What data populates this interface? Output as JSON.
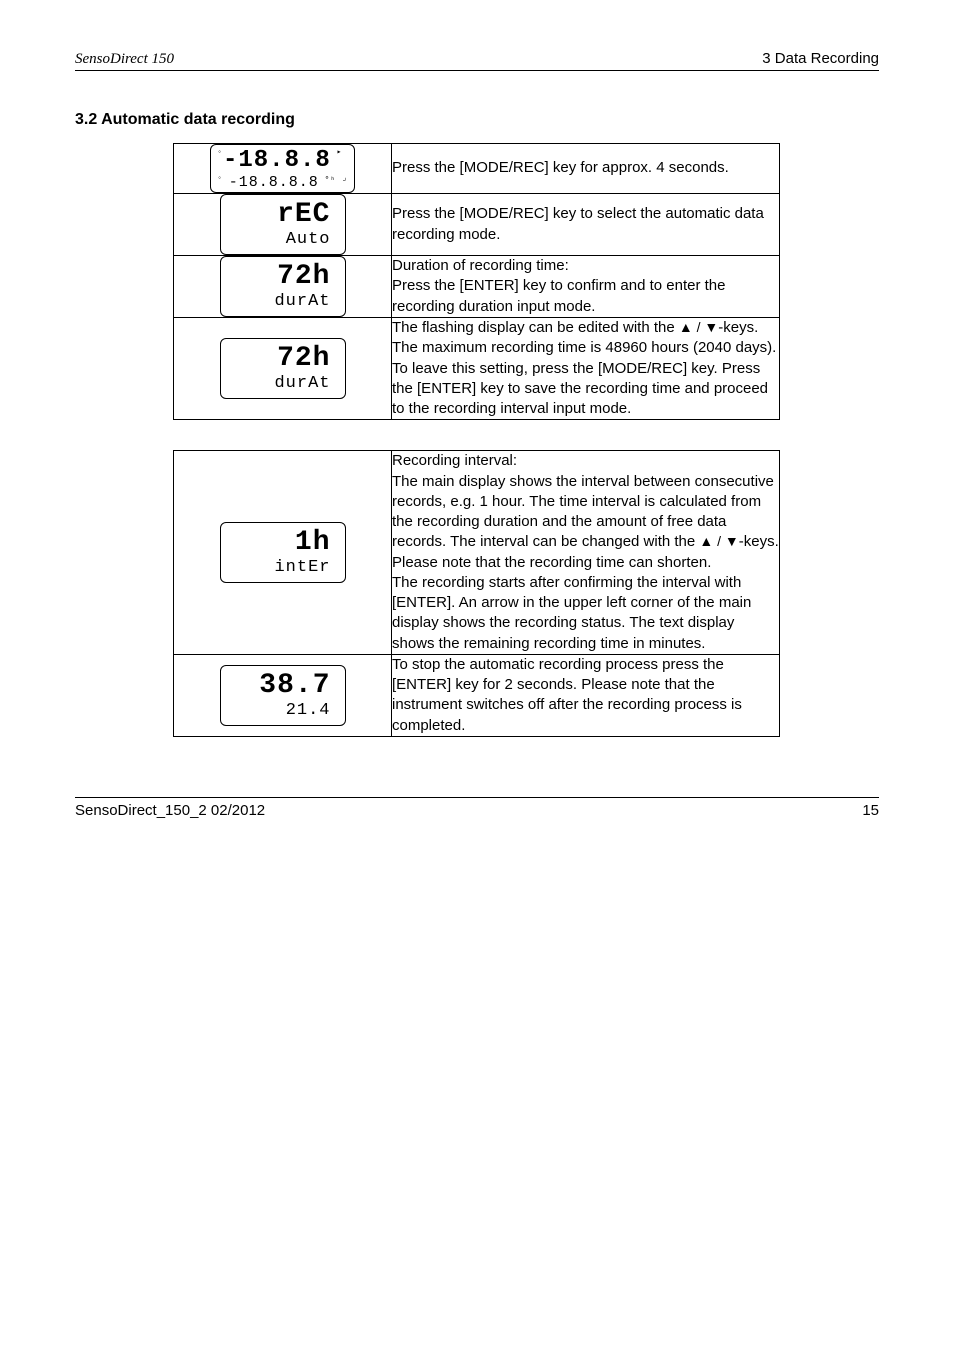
{
  "header": {
    "left": "SensoDirect 150",
    "right": "3 Data Recording"
  },
  "section1": {
    "title": "3.2 Automatic data recording",
    "rows": [
      {
        "lcd_top": "-18.8.8",
        "lcd_bot": "-18.8.8.8",
        "text": "Press the [MODE/REC] key for approx. 4 seconds."
      },
      {
        "lcd_top": "rEC",
        "lcd_bot": "Auto",
        "text": "Press the [MODE/REC] key to select the automatic data recording mode."
      },
      {
        "lcd_top": "72h",
        "lcd_bot": "durAt",
        "text": "Duration of recording time:\nPress the [ENTER] key to confirm and to enter the recording duration input mode."
      },
      {
        "lcd_top": "72h",
        "lcd_bot": "durAt",
        "text_pre": "The flashing display can be edited with the ",
        "tri": "▲ / ▼",
        "text_post": "-keys. The maximum recording time is 48960 hours (2040 days). To leave this setting, press the [MODE/REC] key. Press the [ENTER] key to save the recording time and proceed to the recording interval input mode."
      }
    ]
  },
  "section2": {
    "rows": [
      {
        "lcd_top": "1h",
        "lcd_bot": "intEr",
        "text_pre": "Recording interval:\nThe main display shows the interval between consecutive records, e.g. 1 hour. The time interval is calculated from the recording duration and the amount of free data records. The interval can be changed with the ",
        "tri": "▲ / ▼",
        "text_post": "-keys. Please note that the recording time can shorten.\nThe recording starts after confirming the interval with [ENTER]. An arrow in the upper left corner of the main display shows the recording status. The text display shows the remaining recording time in minutes."
      },
      {
        "lcd_top": "38.7",
        "lcd_bot": "21.4",
        "text": "To stop the automatic recording process press the [ENTER] key for 2 seconds. Please note that the instrument switches off after the recording process is completed."
      }
    ]
  },
  "footer": {
    "left": "SensoDirect_150_2 02/2012",
    "right": "15"
  }
}
